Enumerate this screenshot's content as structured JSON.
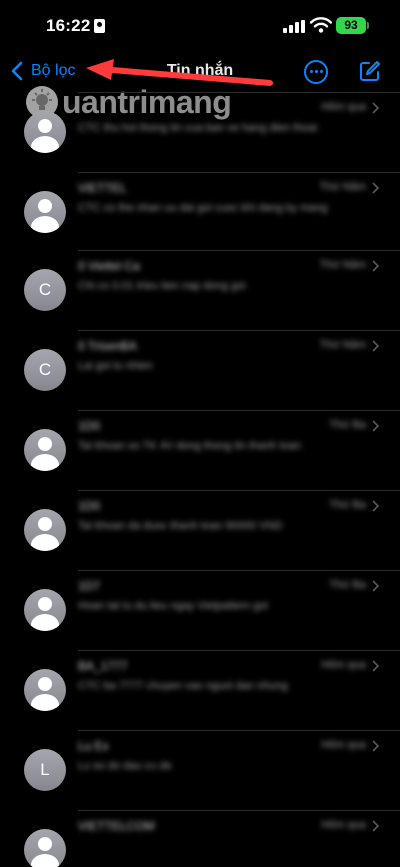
{
  "status": {
    "time": "16:22",
    "battery": "93"
  },
  "nav": {
    "back_label": "Bộ lọc",
    "title": "Tin nhắn"
  },
  "watermark": {
    "text": "uantrimang"
  },
  "colors": {
    "accent": "#0a84ff",
    "arrow": "#ff3b3b",
    "battery": "#32d74b"
  },
  "messages": [
    {
      "avatar": "person",
      "name": "",
      "time": "Hôm qua",
      "preview": "CTC thu hoi thong tin cua ban ve hang dien thoai"
    },
    {
      "avatar": "person",
      "name": "VIETTEL",
      "time": "Thứ Năm",
      "preview": "CTC co the nhan uu dai goi cuoc khi dang ky mang"
    },
    {
      "avatar": "initial",
      "initial": "C",
      "name": "0 Viettel Ca",
      "time": "Thứ Năm",
      "preview": "Chi co 0.01 trieu tien nap dong goi"
    },
    {
      "avatar": "initial",
      "initial": "C",
      "name": "0 TrisenBA",
      "time": "Thứ Năm",
      "preview": "Lai goi tu nhien"
    },
    {
      "avatar": "person",
      "name": "1D0",
      "time": "Thứ Ba",
      "preview": "Tai khoan so TK 4V dong thong tin thanh toan"
    },
    {
      "avatar": "person",
      "name": "1D0",
      "time": "Thứ Ba",
      "preview": "Tai khoan da duoc thanh toan 90000 VND"
    },
    {
      "avatar": "person",
      "name": "1D7",
      "time": "Thứ Ba",
      "preview": "Hoan tat tu du lieu ngay Vietpattern goi"
    },
    {
      "avatar": "person",
      "name": "BA_1777",
      "time": "Hôm qua",
      "preview": "CTC ba 7777 chuyen vao nguoi dan nhung"
    },
    {
      "avatar": "initial",
      "initial": "L",
      "name": "Lu Ex",
      "time": "Hôm qua",
      "preview": "Lu so do dau cu de"
    },
    {
      "avatar": "person",
      "name": "VIETTELCOM",
      "time": "Hôm qua",
      "preview": ""
    }
  ]
}
